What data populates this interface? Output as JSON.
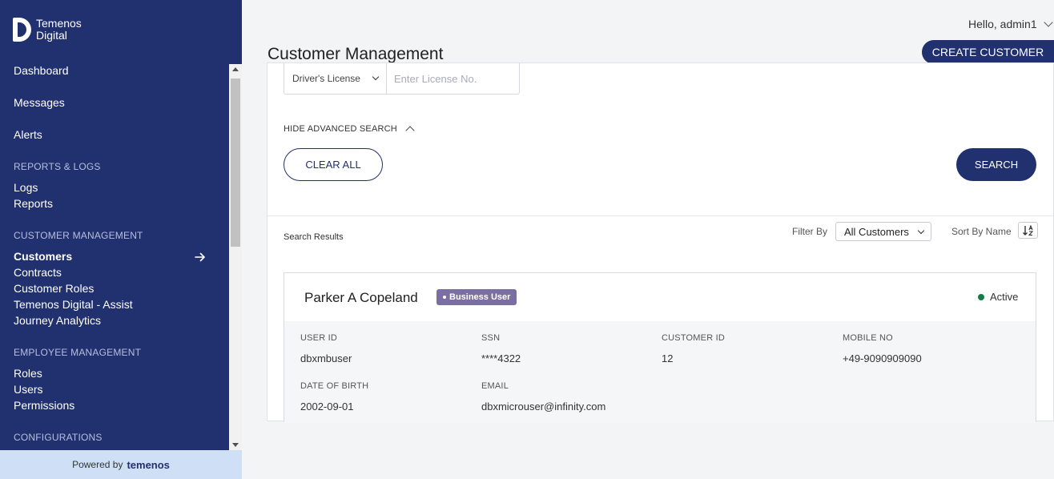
{
  "brand": {
    "line1": "Temenos",
    "line2": "Digital"
  },
  "sidebar": {
    "items": {
      "dashboard": "Dashboard",
      "messages": "Messages",
      "alerts": "Alerts",
      "logs": "Logs",
      "reports": "Reports",
      "customers": "Customers",
      "contracts": "Contracts",
      "customer_roles": "Customer Roles",
      "assist": "Temenos Digital - Assist",
      "journey": "Journey Analytics",
      "roles": "Roles",
      "users": "Users",
      "permissions": "Permissions"
    },
    "sections": {
      "reports_logs": "REPORTS & LOGS",
      "customer_mgmt": "CUSTOMER MANAGEMENT",
      "employee_mgmt": "EMPLOYEE MANAGEMENT",
      "configurations": "CONFIGURATIONS"
    },
    "powered_by": "Powered by",
    "powered_brand": "temenos"
  },
  "header": {
    "greeting": "Hello, admin1",
    "title": "Customer Management",
    "create_label": "CREATE CUSTOMER"
  },
  "search": {
    "id_type": "Driver's License",
    "license_placeholder": "Enter License No.",
    "hide_advanced": "HIDE ADVANCED SEARCH",
    "clear_label": "CLEAR ALL",
    "search_label": "SEARCH"
  },
  "results": {
    "label": "Search Results",
    "filter_label": "Filter By",
    "filter_value": "All Customers",
    "sort_label": "Sort By Name"
  },
  "customer": {
    "name": "Parker A Copeland",
    "badge": "Business User",
    "status": "Active",
    "fields": {
      "user_id_label": "USER ID",
      "user_id": "dbxmbuser",
      "ssn_label": "SSN",
      "ssn": "****4322",
      "customer_id_label": "CUSTOMER ID",
      "customer_id": "12",
      "mobile_label": "MOBILE NO",
      "mobile": "+49-9090909090",
      "dob_label": "DATE OF BIRTH",
      "dob": "2002-09-01",
      "email_label": "EMAIL",
      "email": "dbxmicrouser@infinity.com"
    }
  },
  "colors": {
    "primary": "#21306f",
    "badge": "#7a6ea3",
    "status_active": "#137d49",
    "powered_bg": "#cfe0f6"
  }
}
